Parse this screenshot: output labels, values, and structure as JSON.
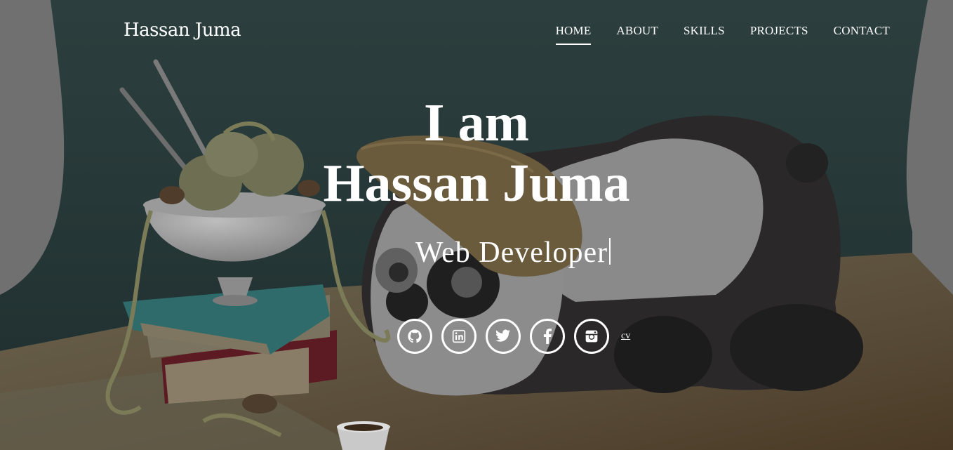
{
  "brand": "Hassan Juma",
  "nav": [
    {
      "label": "HOME",
      "active": true
    },
    {
      "label": "ABOUT"
    },
    {
      "label": "SKILLS"
    },
    {
      "label": "PROJECTS"
    },
    {
      "label": "CONTACT"
    }
  ],
  "hero": {
    "line1": "I am",
    "line2": "Hassan Juma",
    "subtitle": "Web Developer"
  },
  "social": {
    "icons": [
      "github-icon",
      "linkedin-icon",
      "twitter-icon",
      "facebook-icon",
      "instagram-icon"
    ],
    "cv_label": "cv"
  },
  "colors": {
    "backdrop": "#2a3d3c",
    "table": "#5c5240",
    "text": "#ffffff"
  }
}
